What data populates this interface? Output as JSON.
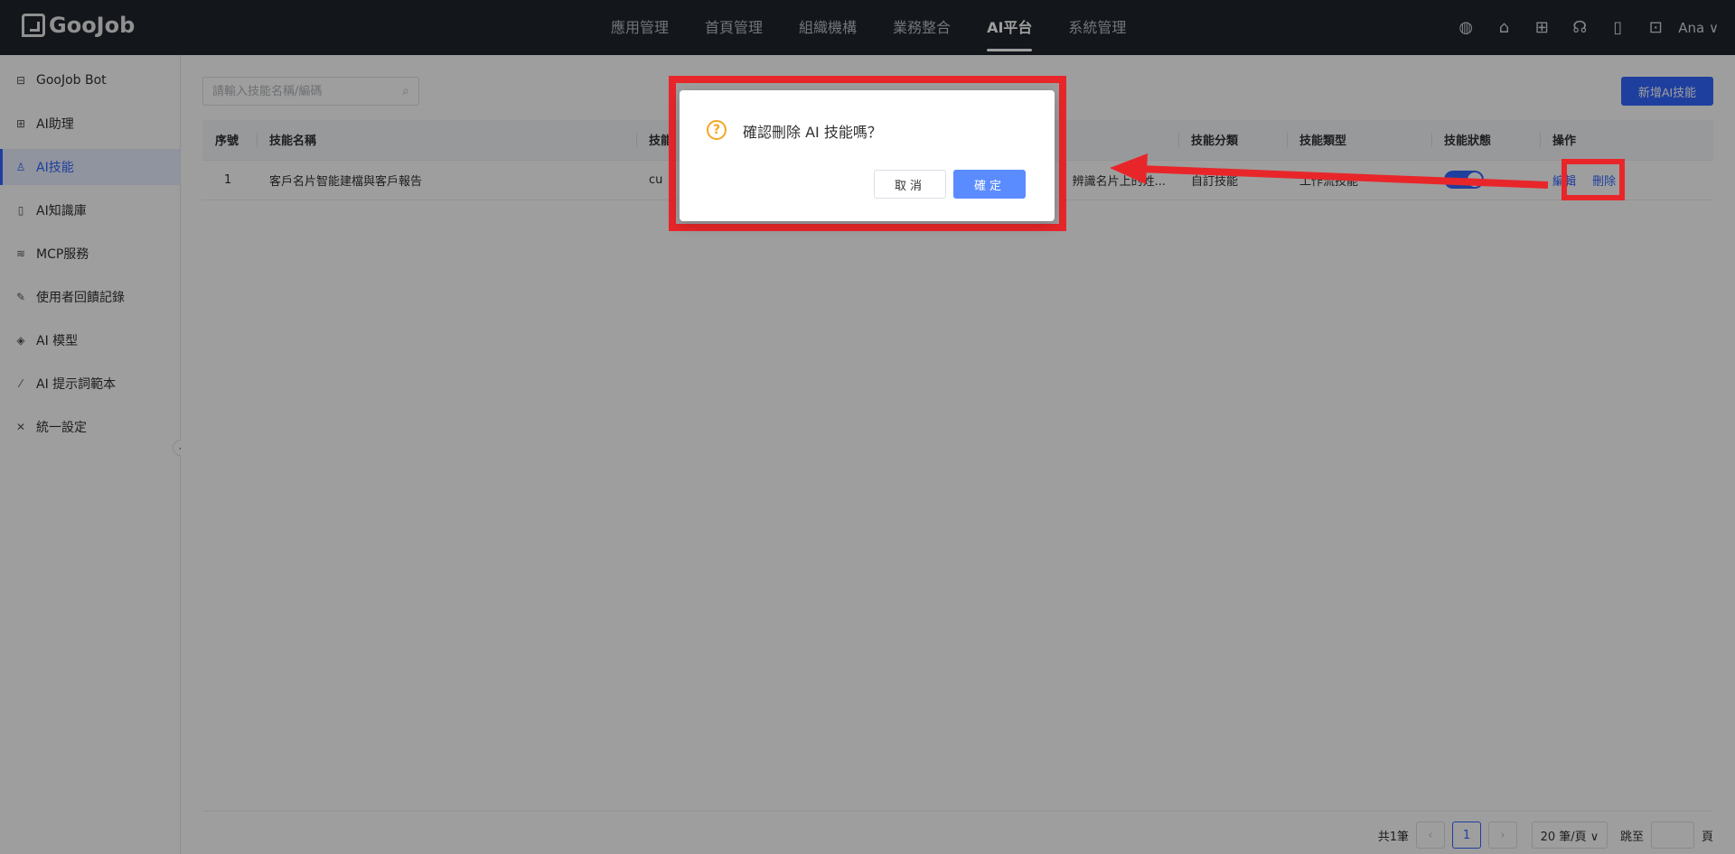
{
  "header": {
    "logo_text": "GooJob",
    "nav": [
      {
        "label": "應用管理"
      },
      {
        "label": "首頁管理"
      },
      {
        "label": "組織機構"
      },
      {
        "label": "業務整合"
      },
      {
        "label": "AI平台"
      },
      {
        "label": "系統管理"
      }
    ],
    "active_nav": "AI平台",
    "tools": [
      "globe-icon",
      "home-icon",
      "grid-icon",
      "headset-icon",
      "book-icon",
      "image-add-icon"
    ],
    "user": "Ana ∨"
  },
  "sidebar": {
    "items": [
      {
        "label": "GooJob Bot",
        "icon": "robot-icon"
      },
      {
        "label": "AI助理",
        "icon": "apps-icon"
      },
      {
        "label": "AI技能",
        "icon": "user-skill-icon"
      },
      {
        "label": "AI知識庫",
        "icon": "book-icon"
      },
      {
        "label": "MCP服務",
        "icon": "layers-icon"
      },
      {
        "label": "使用者回饋記錄",
        "icon": "edit-doc-icon"
      },
      {
        "label": "AI 模型",
        "icon": "cube-icon"
      },
      {
        "label": "AI 提示詞範本",
        "icon": "magic-wand-icon"
      },
      {
        "label": "統一設定",
        "icon": "tools-icon"
      }
    ],
    "active_item": "AI技能"
  },
  "main": {
    "search_placeholder": "請輸入技能名稱/編碼",
    "add_button": "新增AI技能",
    "table": {
      "headers": [
        "序號",
        "技能名稱",
        "技能",
        "",
        "技能分類",
        "技能類型",
        "技能狀態",
        "操作"
      ],
      "rows": [
        {
          "index": "1",
          "name": "客戶名片智能建檔與客戶報告",
          "code": "cu",
          "desc": "辨識名片上的姓...",
          "category": "自訂技能",
          "type": "工作流技能",
          "status_on": true,
          "actions": [
            "編輯",
            "刪除"
          ]
        }
      ]
    },
    "pager": {
      "total": "共1筆",
      "current": "1",
      "page_size": "20 筆/頁 ∨",
      "jump_label": "跳至",
      "page_suffix": "頁"
    }
  },
  "dialog": {
    "message": "確認刪除 AI 技能嗎？",
    "cancel": "取消",
    "ok": "確定"
  },
  "colors": {
    "primary": "#3366ff",
    "header_bg": "#20242c",
    "annotation_red": "#e8262a",
    "warning": "#f5a623"
  }
}
